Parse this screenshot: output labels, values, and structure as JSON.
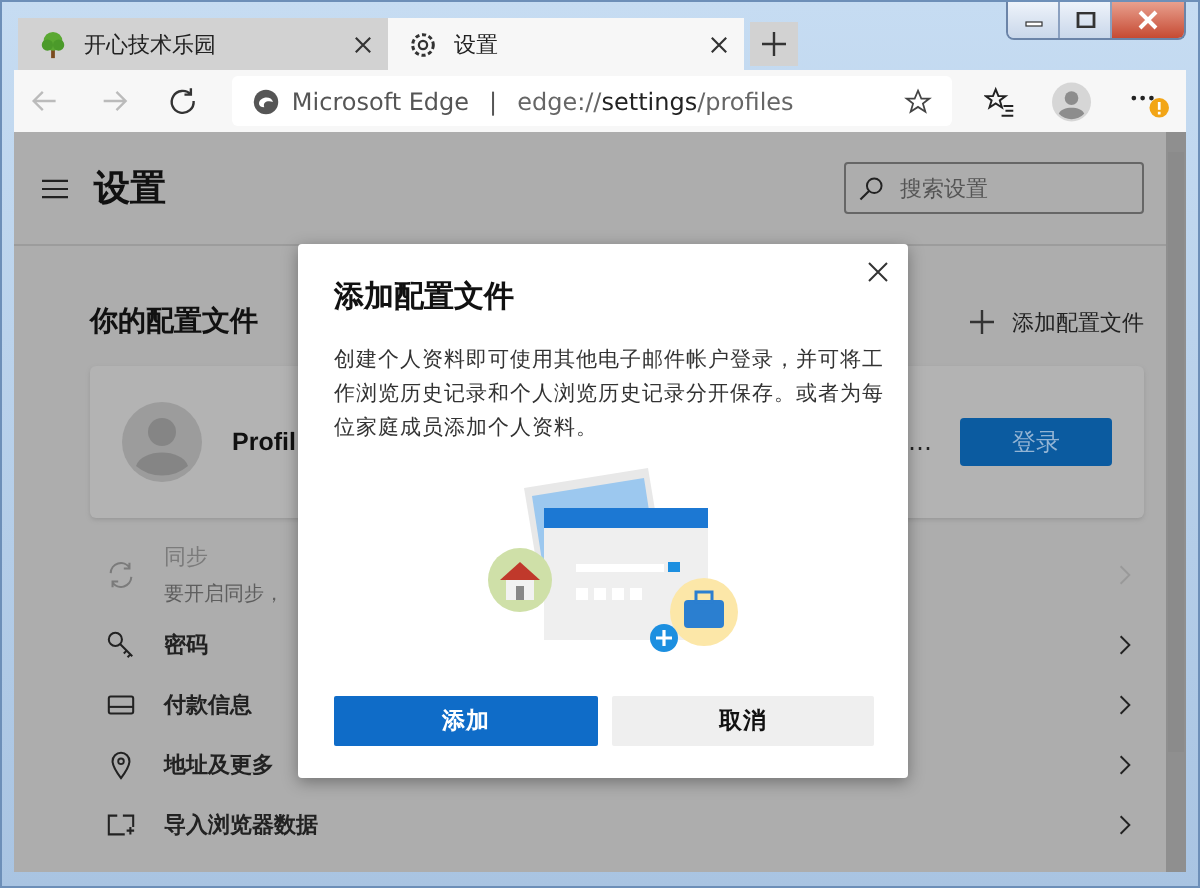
{
  "tabs": [
    {
      "kind": "site",
      "title": "开心技术乐园",
      "selected": false
    },
    {
      "kind": "settings",
      "title": "设置",
      "selected": true
    }
  ],
  "address": {
    "site_label": "Microsoft Edge",
    "separator": "|",
    "url_prefix": "edge://",
    "url_host": "settings",
    "url_path": "/profiles"
  },
  "settings": {
    "title": "设置",
    "search_placeholder": "搜索设置",
    "section_title": "你的配置文件",
    "add_profile": "添加配置文件",
    "profile_name": "Profil",
    "more": "…",
    "sign_in": "登录",
    "items": [
      {
        "kind": "sync",
        "label": "同步",
        "subtitle": "要开启同步，",
        "disabled": true
      },
      {
        "kind": "key",
        "label": "密码",
        "disabled": false
      },
      {
        "kind": "card",
        "label": "付款信息",
        "disabled": false
      },
      {
        "kind": "pin",
        "label": "地址及更多",
        "disabled": false
      },
      {
        "kind": "import",
        "label": "导入浏览器数据",
        "disabled": false
      }
    ]
  },
  "dialog": {
    "title": "添加配置文件",
    "description": "创建个人资料即可使用其他电子邮件帐户登录，并可将工作浏览历史记录和个人浏览历史记录分开保存。或者为每位家庭成员添加个人资料。",
    "primary": "添加",
    "secondary": "取消"
  }
}
